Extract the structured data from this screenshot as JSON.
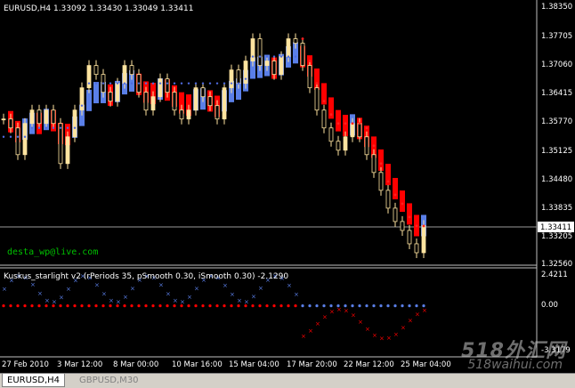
{
  "main_chart": {
    "header": "EURUSD,H4  1.33092 1.33430 1.33049 1.33411",
    "watermark_email": "desta_wp@live.com",
    "price_labels": [
      "1.38350",
      "1.37705",
      "1.37060",
      "1.36415",
      "1.35770",
      "1.35125",
      "1.34480",
      "1.33835",
      "1.33205",
      "1.32560"
    ],
    "current_price": "1.33411"
  },
  "indicator": {
    "header": "Kuskus_starlight v2 (rPeriods 35, pSmooth 0.30, iSmooth 0.30)   -2.1290",
    "labels": [
      "2.4211",
      "0.00",
      "-3.3179"
    ]
  },
  "time_labels": [
    "27 Feb 2010",
    "3 Mar 12:00",
    "8 Mar 00:00",
    "10 Mar 16:00",
    "15 Mar 04:00",
    "17 Mar 20:00",
    "22 Mar 12:00",
    "25 Mar 04:00"
  ],
  "tabs": [
    {
      "label": "EURUSD,H4"
    },
    {
      "label": "GBPUSD,M30"
    }
  ],
  "watermark": {
    "line1": "518外汇网",
    "line2": "518waihui.com"
  },
  "colors": {
    "up_candle": "#ffe4a0",
    "band_red": "#ff0000",
    "band_blue": "#5a7fe8",
    "dots_blue": "#4f6be0",
    "dots_red": "#ff2020",
    "email": "#00c000"
  },
  "chart_data": {
    "type": "candlestick",
    "close_series_approx": [
      1.358,
      1.356,
      1.35,
      1.357,
      1.36,
      1.357,
      1.36,
      1.357,
      1.348,
      1.354,
      1.36,
      1.365,
      1.37,
      1.368,
      1.364,
      1.362,
      1.366,
      1.37,
      1.368,
      1.364,
      1.36,
      1.363,
      1.367,
      1.364,
      1.36,
      1.358,
      1.36,
      1.365,
      1.363,
      1.361,
      1.358,
      1.365,
      1.369,
      1.366,
      1.371,
      1.376,
      1.37,
      1.371,
      1.368,
      1.372,
      1.376,
      1.375,
      1.37,
      1.365,
      1.36,
      1.356,
      1.353,
      1.351,
      1.354,
      1.357,
      1.354,
      1.35,
      1.346,
      1.342,
      1.338,
      1.335,
      1.333,
      1.33,
      1.328,
      1.3341
    ],
    "y_range": [
      1.3256,
      1.3835
    ],
    "x_labels": [
      "27 Feb 2010",
      "3 Mar 12:00",
      "8 Mar 00:00",
      "10 Mar 16:00",
      "15 Mar 04:00",
      "17 Mar 20:00",
      "22 Mar 12:00",
      "25 Mar 04:00"
    ],
    "indicator_range": [
      -3.3179,
      2.4211
    ]
  }
}
